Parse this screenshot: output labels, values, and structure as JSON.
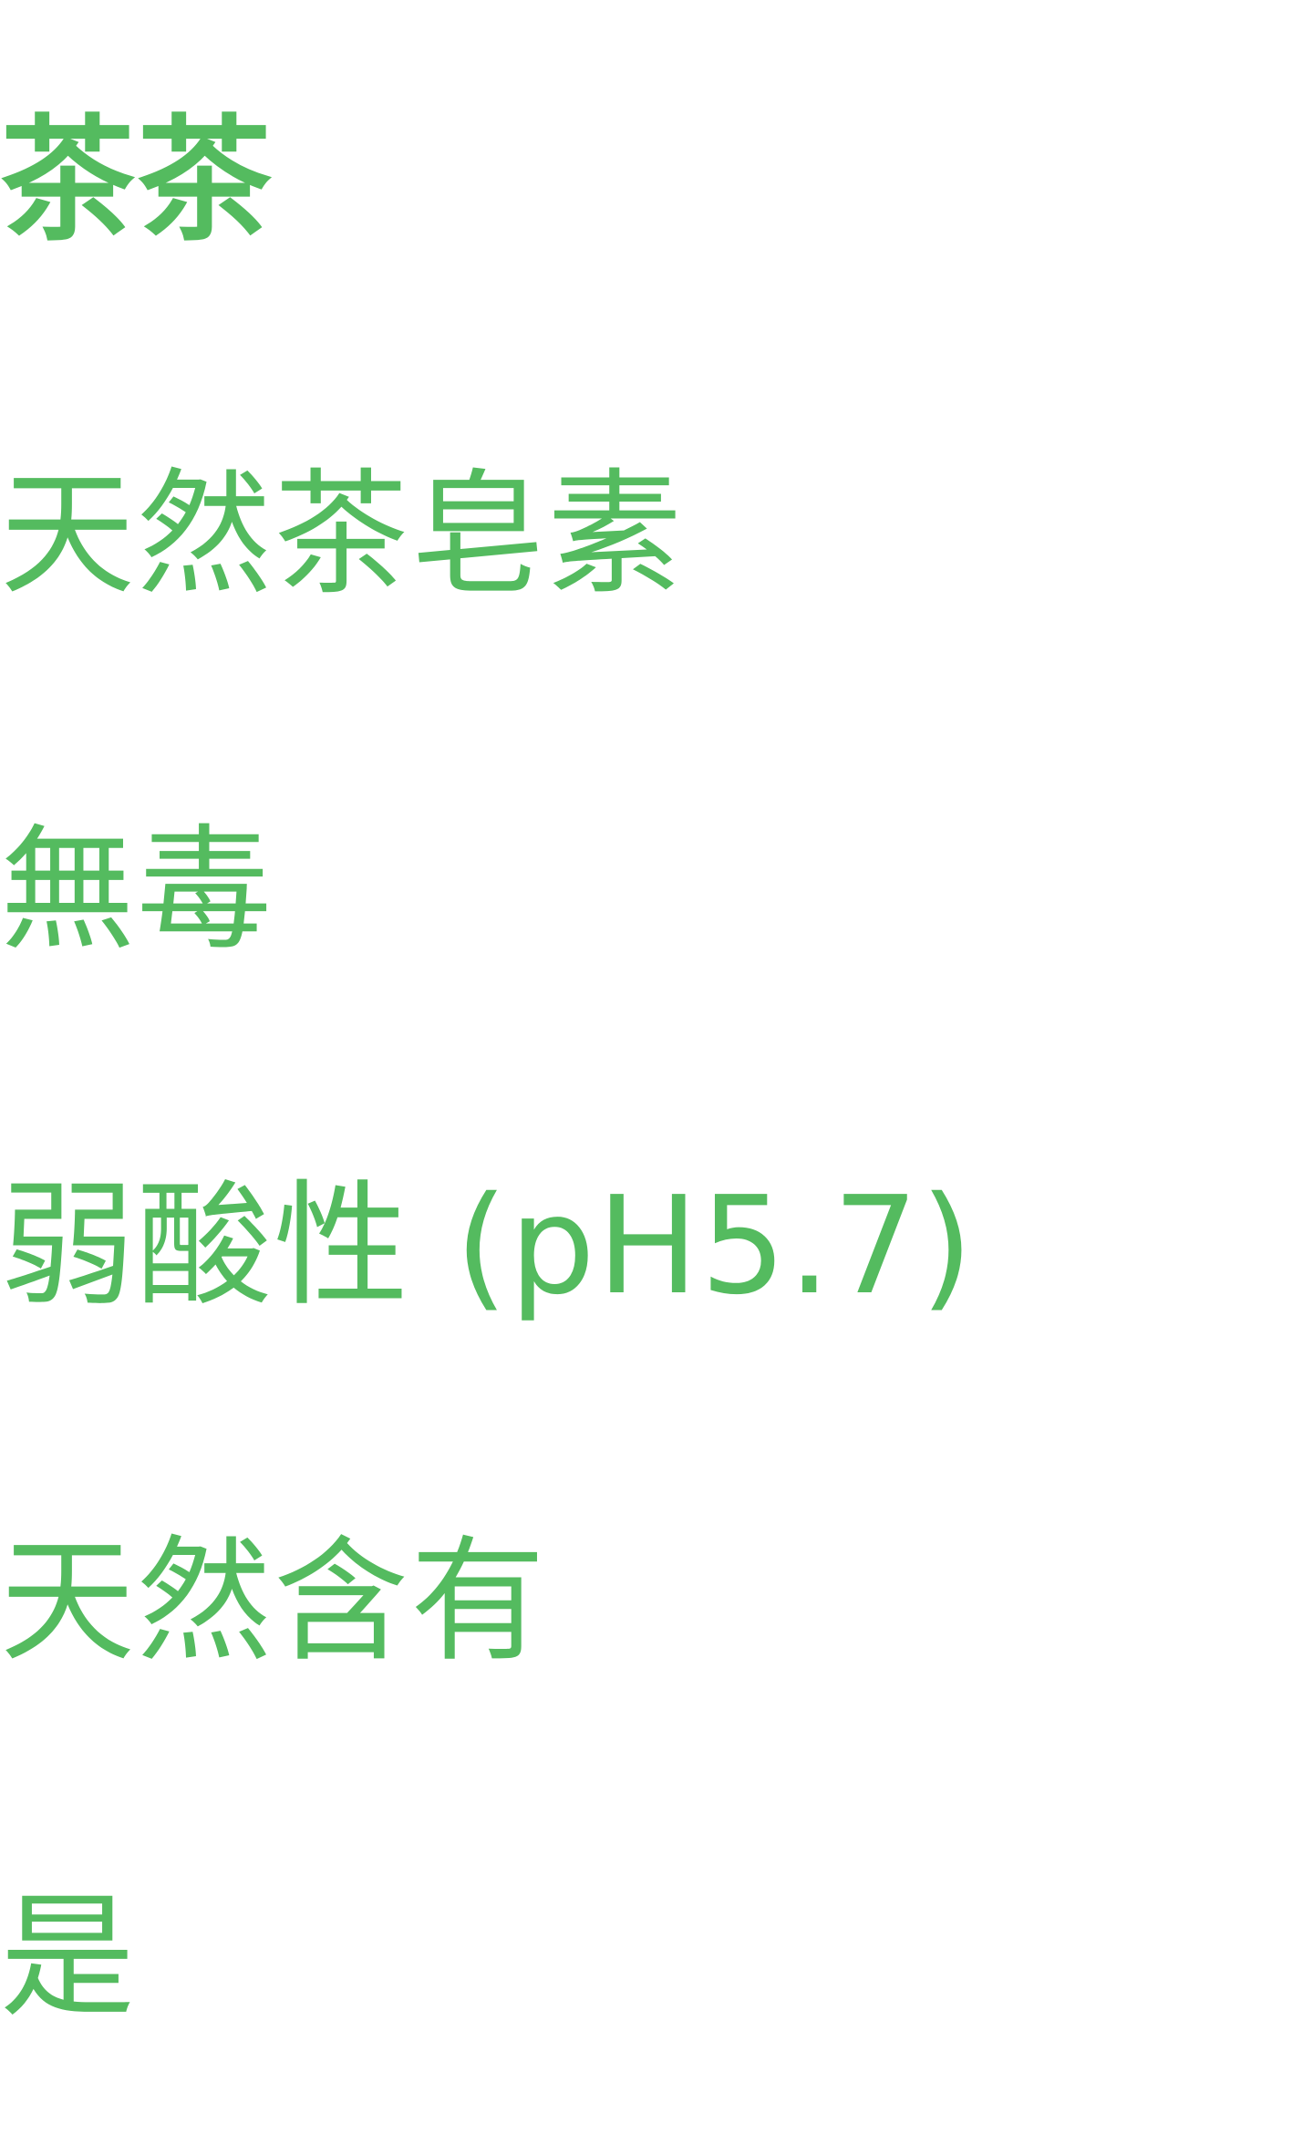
{
  "title": "茶茶",
  "items": [
    {
      "text": "天然茶皂素"
    },
    {
      "text": "無毒"
    },
    {
      "text": "弱酸性 (pH5.7)"
    },
    {
      "text": "天然含有"
    },
    {
      "text": "是"
    }
  ],
  "colors": {
    "accent": "#54bb5f",
    "background": "#ffffff"
  }
}
